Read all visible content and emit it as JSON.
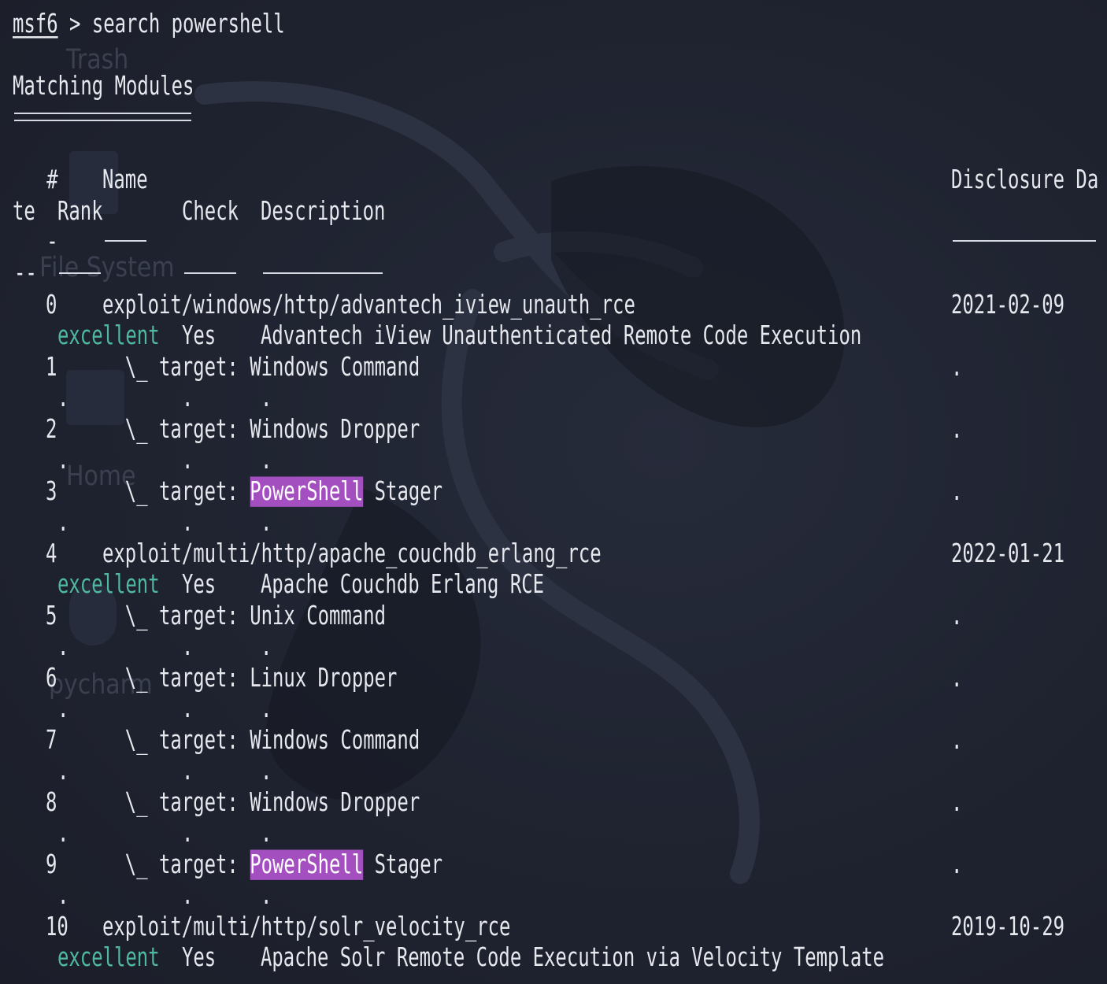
{
  "theme": {
    "background": "#1f2330",
    "foreground": "#e6e8ee",
    "rank_color": "#4fb99f",
    "highlight_bg": "#a34fc0"
  },
  "desktop_icons": [
    "Trash",
    "File System",
    "Home",
    "pycharm"
  ],
  "command": {
    "prompt": "msf6",
    "separator": " > ",
    "text": "search powershell"
  },
  "section_title": "Matching Modules",
  "headers": {
    "line1_hash": "   #",
    "line1_name": "Name",
    "line1_disclosure": "Disclosure Da",
    "line2_wrap": "te",
    "line2_rank": "Rank",
    "line2_check": "Check",
    "line2_desc": "Description",
    "line3_dash": "   -",
    "line4_dash": "--"
  },
  "rows": [
    {
      "num": "0",
      "name": "exploit/windows/http/advantech_iview_unauth_rce",
      "date": "2021-02-09",
      "rank": "excellent",
      "check": "Yes",
      "description": "Advantech iView Unauthenticated Remote Code Execution"
    },
    {
      "num": "1",
      "target_prefix": "  \\_ target: ",
      "target": "Windows Command",
      "date": "."
    },
    {
      "num": "2",
      "target_prefix": "  \\_ target: ",
      "target": "Windows Dropper",
      "date": "."
    },
    {
      "num": "3",
      "target_prefix": "  \\_ target: ",
      "target_hl": "PowerShell",
      "target_rest": " Stager",
      "date": "."
    },
    {
      "num": "4",
      "name": "exploit/multi/http/apache_couchdb_erlang_rce",
      "date": "2022-01-21",
      "rank": "excellent",
      "check": "Yes",
      "description": "Apache Couchdb Erlang RCE"
    },
    {
      "num": "5",
      "target_prefix": "  \\_ target: ",
      "target": "Unix Command",
      "date": "."
    },
    {
      "num": "6",
      "target_prefix": "  \\_ target: ",
      "target": "Linux Dropper",
      "date": "."
    },
    {
      "num": "7",
      "target_prefix": "  \\_ target: ",
      "target": "Windows Command",
      "date": "."
    },
    {
      "num": "8",
      "target_prefix": "  \\_ target: ",
      "target": "Windows Dropper",
      "date": "."
    },
    {
      "num": "9",
      "target_prefix": "  \\_ target: ",
      "target_hl": "PowerShell",
      "target_rest": " Stager",
      "date": "."
    },
    {
      "num": "10",
      "name": "exploit/multi/http/solr_velocity_rce",
      "date": "2019-10-29",
      "rank": "excellent",
      "check": "Yes",
      "description": "Apache Solr Remote Code Execution via Velocity Template"
    }
  ],
  "wrap_dots": {
    "rank": ".",
    "check": ".",
    "desc": "."
  }
}
